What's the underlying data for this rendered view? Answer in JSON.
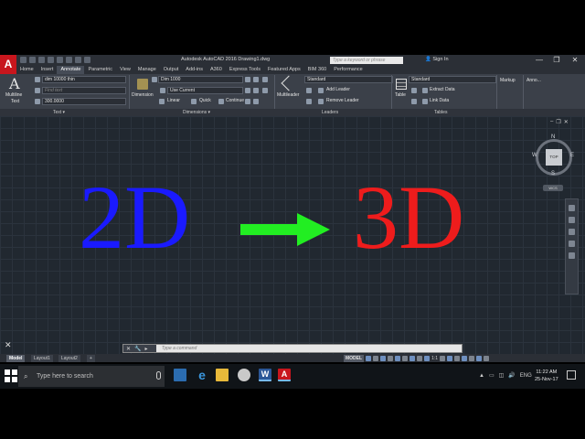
{
  "app": {
    "logo_letter": "A",
    "title": "Autodesk AutoCAD 2016   Drawing1.dwg",
    "search_placeholder": "Type a keyword or phrase",
    "sign_in": "Sign In",
    "minimize": "—",
    "maximize": "❐",
    "close": "✕"
  },
  "ribbon_tabs": [
    "Home",
    "Insert",
    "Annotate",
    "Parametric",
    "View",
    "Manage",
    "Output",
    "Add-ins",
    "A360",
    "Express Tools",
    "Featured Apps",
    "BIM 360",
    "Performance"
  ],
  "active_tab_index": 2,
  "text_panel": {
    "multiline_label": "Multiline",
    "multiline_label2": "Text",
    "style": "dim 10000 thin",
    "find_placeholder": "Find text",
    "height": "300.0000",
    "label": "Text"
  },
  "dimensions_panel": {
    "dimension_label": "Dimension",
    "style": "Dim 1000",
    "layer": "Use Current",
    "linear": "Linear",
    "quick": "Quick",
    "continue": "Continue",
    "label": "Dimensions"
  },
  "leaders_panel": {
    "multileader_label": "Multileader",
    "style": "Standard",
    "add_leader": "Add Leader",
    "remove_leader": "Remove Leader",
    "label": "Leaders"
  },
  "tables_panel": {
    "table_label": "Table",
    "style": "Standard",
    "extract_data": "Extract Data",
    "link_data": "Link Data",
    "label": "Tables"
  },
  "markup_panel": {
    "label": "Markup"
  },
  "anno_panel": {
    "label": "Anno..."
  },
  "canvas": {
    "text_2d": "2D",
    "text_3d": "3D",
    "color_2d": "#1a1aff",
    "color_3d": "#ee1c1c",
    "arrow_color": "#22ee22",
    "viewcube": {
      "top": "TOP",
      "n": "N",
      "s": "S",
      "e": "E",
      "w": "W",
      "wcs": "WCS"
    }
  },
  "command_line": {
    "placeholder": "Type a command"
  },
  "layout_tabs": [
    "Model",
    "Layout1",
    "Layout2"
  ],
  "add_layout": "+",
  "status": {
    "model": "MODEL",
    "scale": "1:1"
  },
  "taskbar": {
    "search_placeholder": "Type here to search",
    "language": "ENG",
    "time": "11:22 AM",
    "date": "25-Nov-17"
  }
}
